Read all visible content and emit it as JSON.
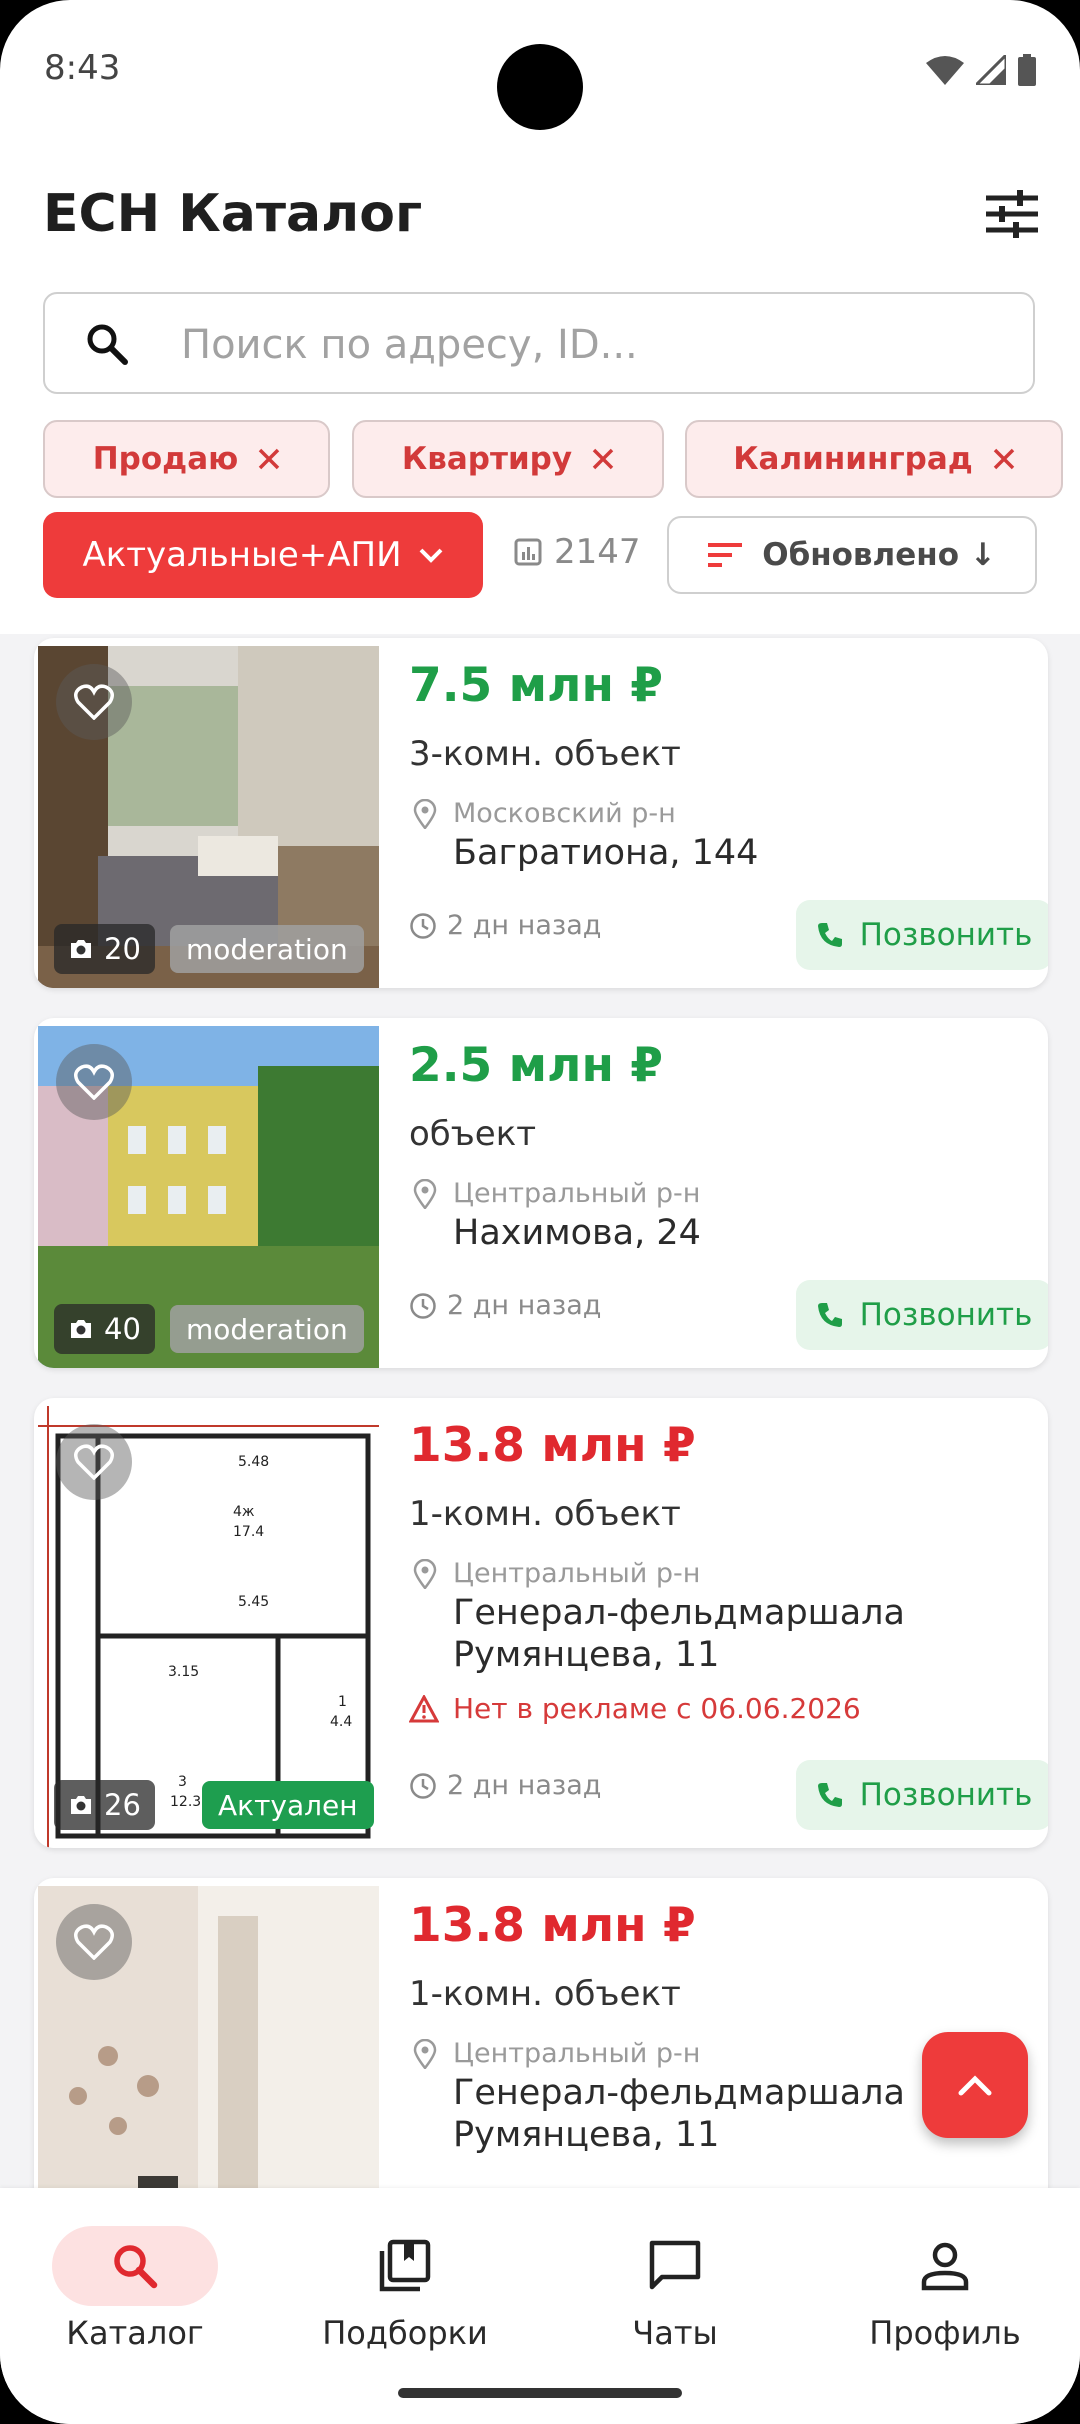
{
  "status_bar": {
    "time": "8:43"
  },
  "header": {
    "title": "ЕСН Каталог"
  },
  "search": {
    "placeholder": "Поиск по адресу, ID..."
  },
  "filter_chips": [
    {
      "label": "Продаю"
    },
    {
      "label": "Квартиру"
    },
    {
      "label": "Калининград"
    }
  ],
  "status_filter": {
    "label": "Актуальные+АПИ"
  },
  "results": {
    "count": "2147"
  },
  "sort": {
    "label": "Обновлено ↓"
  },
  "listings": [
    {
      "price": "7.5 млн ₽",
      "price_color": "#1f9e48",
      "type": "3-комн. объект",
      "district": "Московский р-н",
      "address": "Багратиона, 144",
      "warning": null,
      "updated": "2 дн назад",
      "photos": "20",
      "badge": "moderation",
      "call": "Позвонить"
    },
    {
      "price": "2.5 млн ₽",
      "price_color": "#1f9e48",
      "type": "объект",
      "district": "Центральный р-н",
      "address": "Нахимова, 24",
      "warning": null,
      "updated": "2 дн назад",
      "photos": "40",
      "badge": "moderation",
      "call": "Позвонить"
    },
    {
      "price": "13.8 млн ₽",
      "price_color": "#e0292f",
      "type": "1-комн. объект",
      "district": "Центральный р-н",
      "address": "Генерал-фельдмаршала Румянцева, 11",
      "warning": "Нет в рекламе с 06.06.2026",
      "updated": "2 дн назад",
      "photos": "26",
      "badge": "Актуален",
      "call": "Позвонить"
    },
    {
      "price": "13.8 млн ₽",
      "price_color": "#e0292f",
      "type": "1-комн. объект",
      "district": "Центральный р-н",
      "address": "Генерал-фельдмаршала Румянцева, 11"
    }
  ],
  "bottom_nav": [
    {
      "label": "Каталог",
      "icon": "search-icon",
      "active": true
    },
    {
      "label": "Подборки",
      "icon": "collections-icon",
      "active": false
    },
    {
      "label": "Чаты",
      "icon": "chat-icon",
      "active": false
    },
    {
      "label": "Профиль",
      "icon": "profile-icon",
      "active": false
    }
  ],
  "colors": {
    "accent": "#ee3b3b",
    "price_green": "#1f9e48",
    "price_red": "#e0292f",
    "call_bg": "#e6f5ea"
  }
}
